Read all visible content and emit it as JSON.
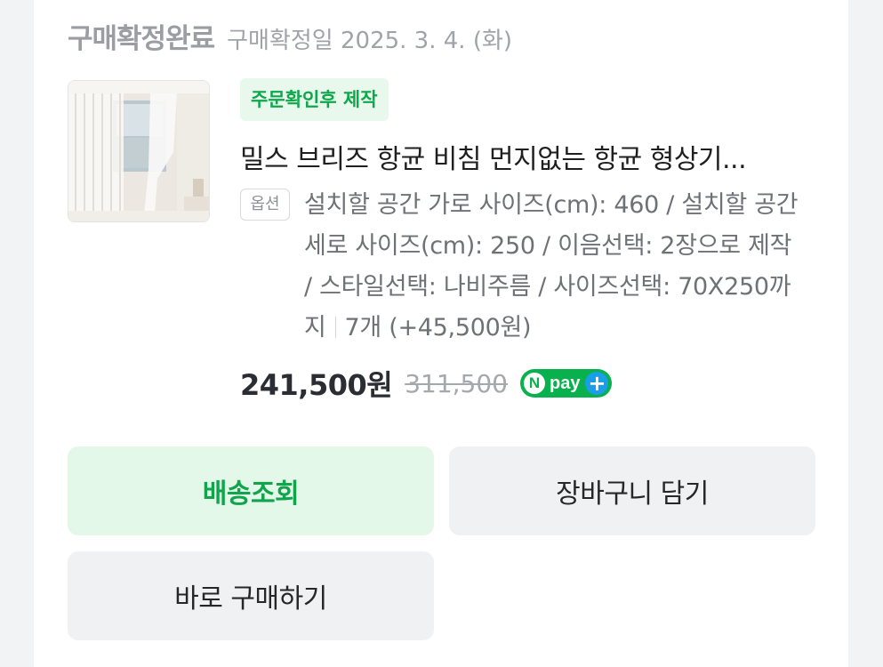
{
  "order": {
    "status": "구매확정완료",
    "confirm_date": "구매확정일 2025. 3. 4. (화)"
  },
  "product": {
    "tag": "주문확인후 제작",
    "title": "밀스 브리즈 항균 비침 먼지없는 항균 형상기...",
    "option_label": "옵션",
    "options": "설치할 공간 가로 사이즈(cm): 460 / 설치할 공간 세로 사이즈(cm): 250 / 이음선택: 2장으로 제작 / 스타일선택: 나비주름 / 사이즈선택: 70X250까지",
    "quantity": "7개 (+45,500원)",
    "price": "241,500원",
    "original_price": "311,500",
    "npay": {
      "n": "N",
      "text": "pay",
      "plus": "+"
    }
  },
  "buttons": {
    "track": "배송조회",
    "cart": "장바구니 담기",
    "buy": "바로 구매하기"
  },
  "colors": {
    "green": "#10a54c",
    "green_bg": "#e4f8e9",
    "gray_btn": "#eff1f3",
    "npay_blue": "#1a9ee8"
  },
  "icons": {
    "npay": "npay-plus-badge",
    "thumbnail": "curtain-product-image"
  }
}
